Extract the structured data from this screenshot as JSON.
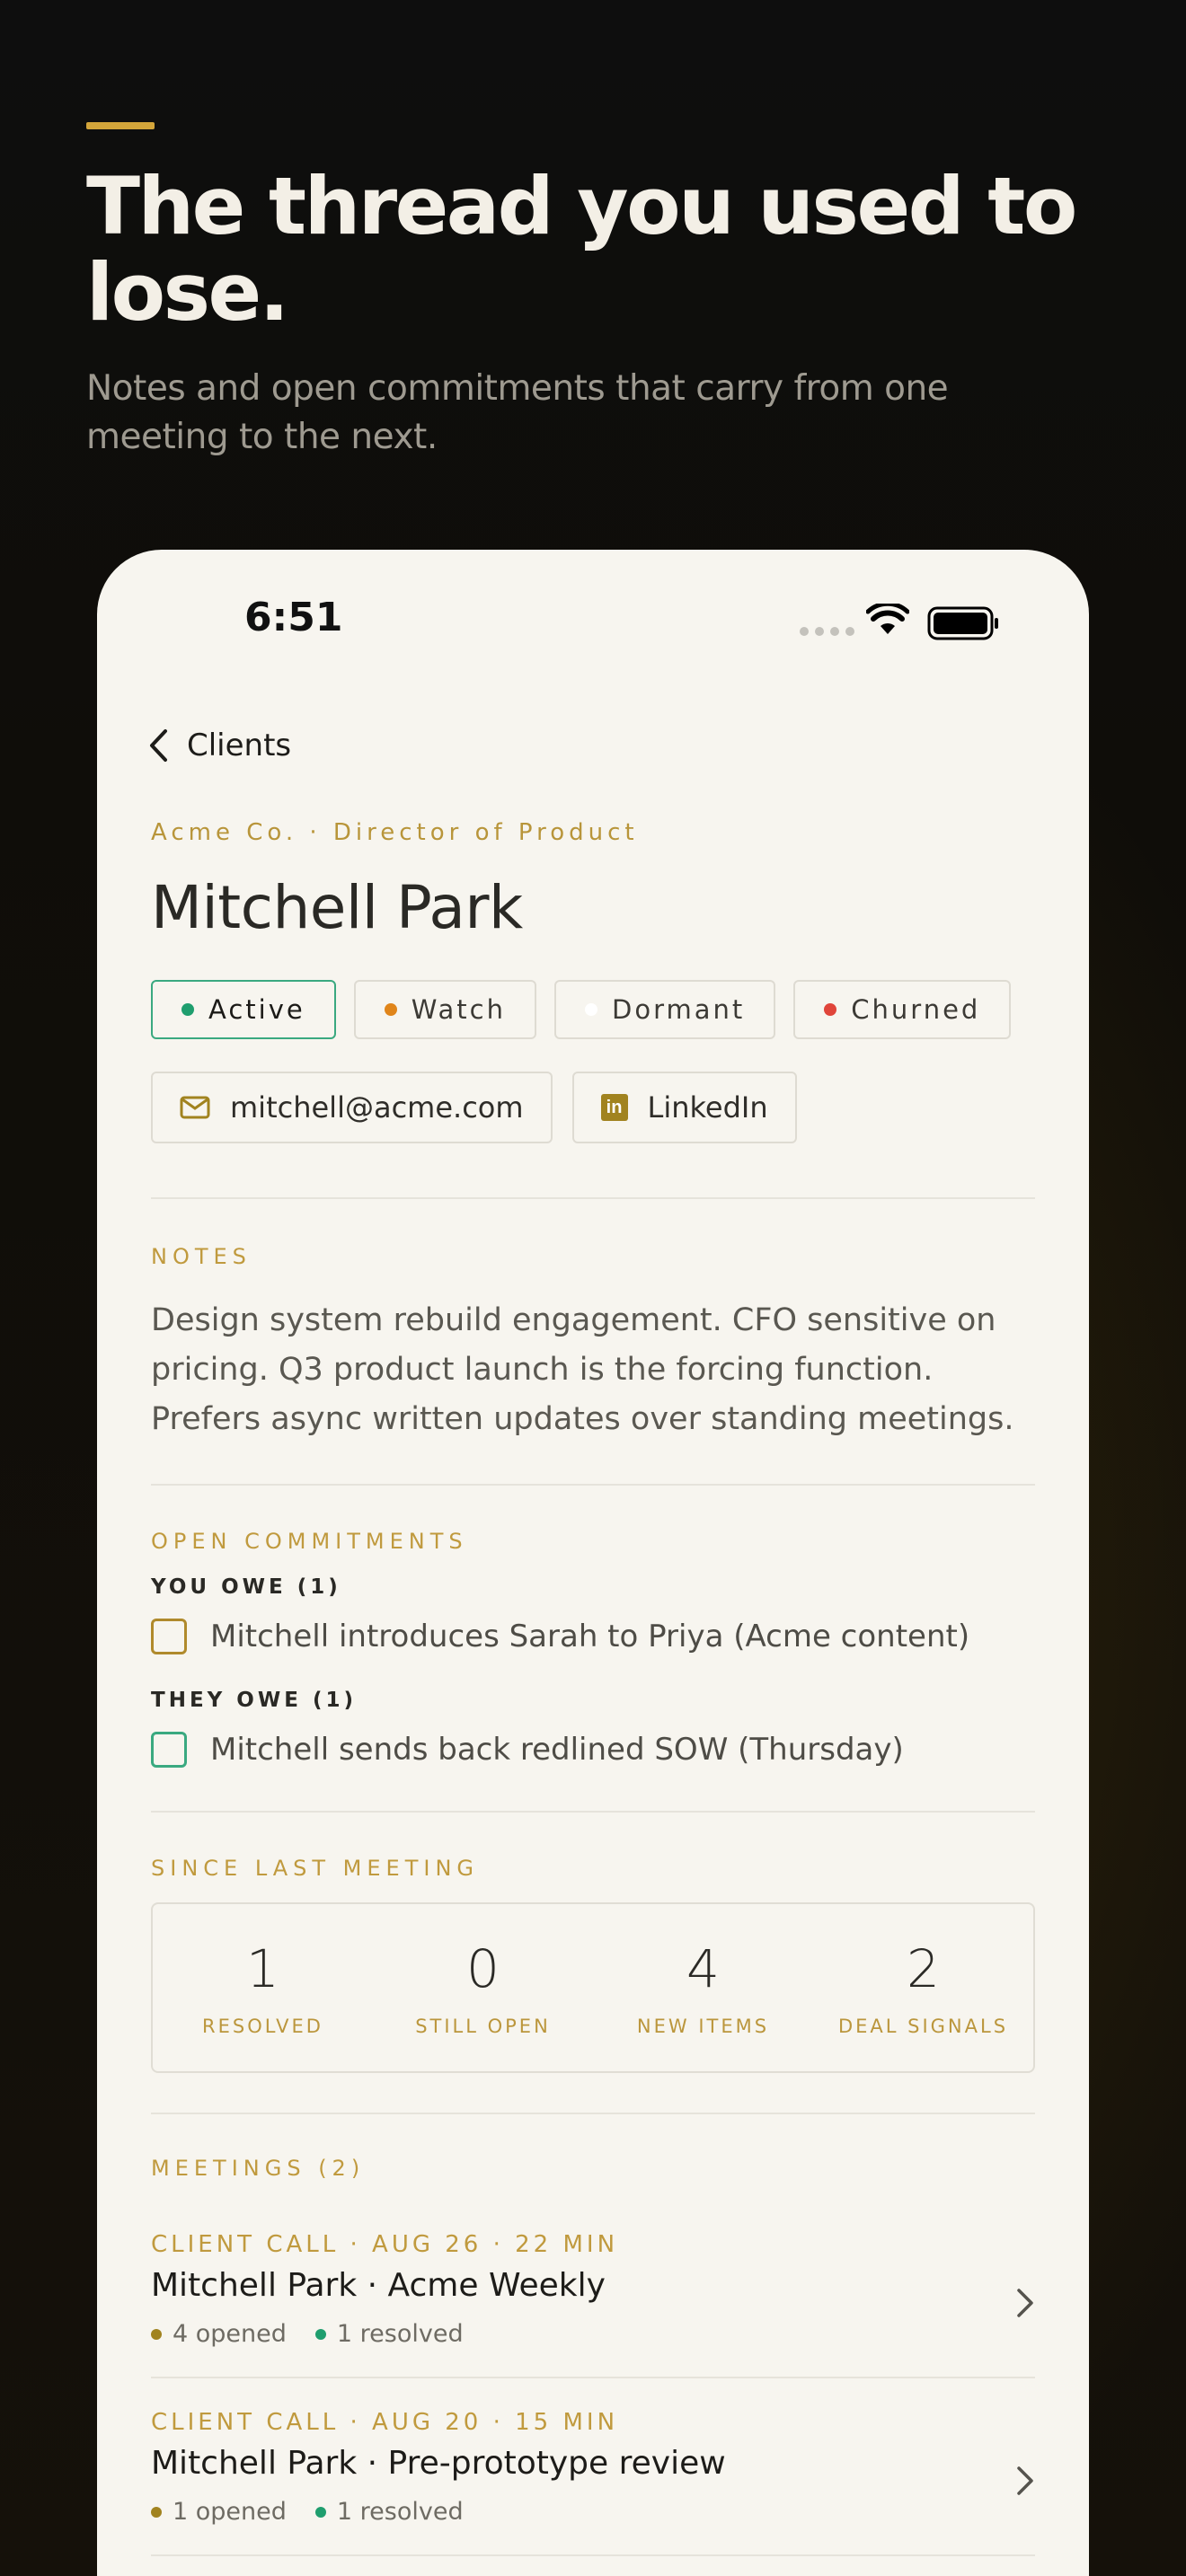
{
  "hero": {
    "title": "The thread you used to lose.",
    "subtitle": "Notes and open commitments that carry from one meeting to the next."
  },
  "status_bar": {
    "time": "6:51"
  },
  "nav": {
    "back_label": "Clients"
  },
  "client": {
    "eyebrow": "Acme Co. · Director of Product",
    "name": "Mitchell Park",
    "status_chips": [
      {
        "label": "Active",
        "color": "#1f9e6e"
      },
      {
        "label": "Watch",
        "color": "#e0851a"
      },
      {
        "label": "Dormant",
        "color": "#ffffff"
      },
      {
        "label": "Churned",
        "color": "#e0453a"
      }
    ],
    "email": "mitchell@acme.com",
    "linkedin_label": "LinkedIn"
  },
  "notes": {
    "label": "NOTES",
    "text": "Design system rebuild engagement. CFO sensitive on pricing. Q3 product launch is the forcing function. Prefers async written updates over standing meetings."
  },
  "commitments": {
    "label": "OPEN COMMITMENTS",
    "you_owe_label": "YOU OWE (1)",
    "you_owe": [
      "Mitchell introduces Sarah to Priya (Acme content)"
    ],
    "they_owe_label": "THEY OWE (1)",
    "they_owe": [
      "Mitchell sends back redlined SOW (Thursday)"
    ]
  },
  "since_last": {
    "label": "SINCE LAST MEETING",
    "stats": [
      {
        "value": "1",
        "label": "RESOLVED"
      },
      {
        "value": "0",
        "label": "STILL OPEN"
      },
      {
        "value": "4",
        "label": "NEW ITEMS"
      },
      {
        "value": "2",
        "label": "DEAL SIGNALS"
      }
    ]
  },
  "meetings": {
    "label": "MEETINGS (2)",
    "items": [
      {
        "meta": "CLIENT CALL · AUG 26 · 22 MIN",
        "title": "Mitchell Park · Acme Weekly",
        "opened": "4 opened",
        "resolved": "1 resolved"
      },
      {
        "meta": "CLIENT CALL · AUG 20 · 15 MIN",
        "title": "Mitchell Park · Pre-prototype review",
        "opened": "1 opened",
        "resolved": "1 resolved"
      }
    ]
  },
  "colors": {
    "accent_gold": "#c09a3e",
    "active_green": "#3aa980",
    "opened_dot": "#a1831f",
    "resolved_dot": "#1f9e6e"
  }
}
